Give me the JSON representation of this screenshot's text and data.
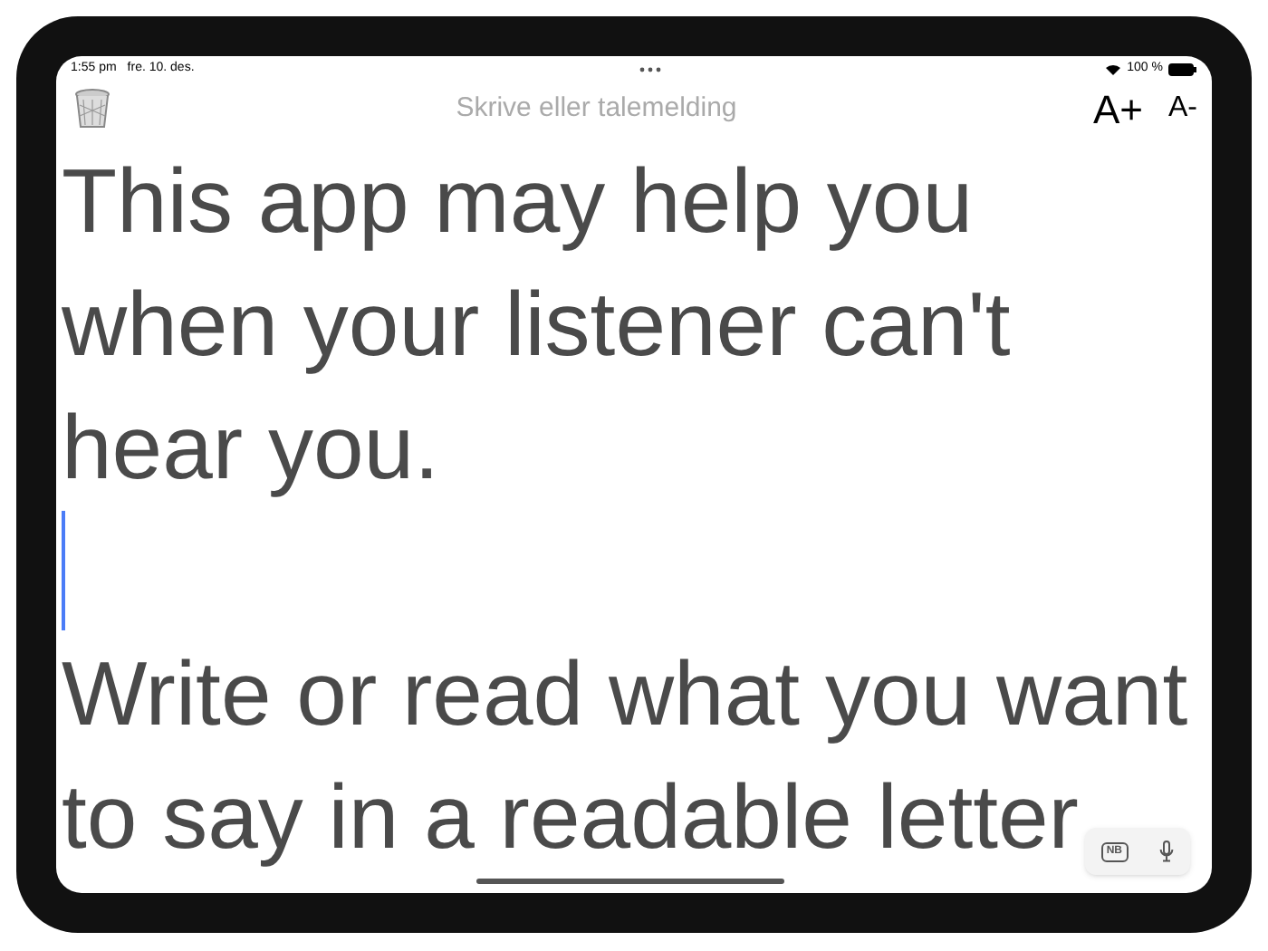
{
  "status_bar": {
    "time": "1:55 pm",
    "date": "fre. 10. des.",
    "battery": "100 %"
  },
  "toolbar": {
    "title": "Skrive eller talemelding",
    "buttons": [
      "A+",
      "A-"
    ]
  },
  "editor": {
    "blocks": [
      {
        "kind": "text",
        "lines": [
          "This app may help you",
          "when your listener can't",
          "hear you."
        ]
      },
      {
        "kind": "caret"
      },
      {
        "kind": "text",
        "lines": [
          "Write or read what you want",
          "to say in a readable letter"
        ]
      }
    ]
  },
  "input_bar": {
    "language": "NB"
  }
}
